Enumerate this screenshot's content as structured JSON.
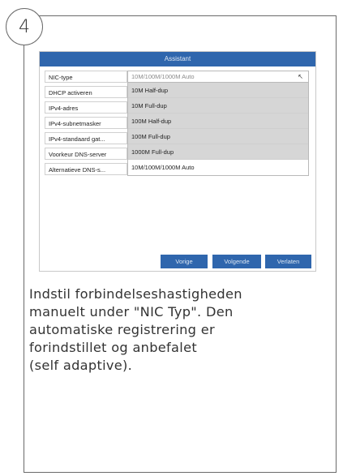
{
  "step_number": "4",
  "window": {
    "title": "Assistant"
  },
  "form": {
    "labels": [
      "NIC-type",
      "DHCP activeren",
      "IPv4-adres",
      "IPv4-subnetmasker",
      "IPv4-standaard gat...",
      "Voorkeur DNS-server",
      "Alternatieve DNS-s..."
    ],
    "nic_type_selected": "10M/100M/1000M Auto",
    "nic_type_options": [
      "10M Half-dup",
      "10M Full-dup",
      "100M Half-dup",
      "100M Full-dup",
      "1000M Full-dup",
      "10M/100M/1000M Auto"
    ]
  },
  "buttons": {
    "previous": "Vorige",
    "next": "Volgende",
    "exit": "Verlaten"
  },
  "caption": "Indstil forbindelseshastigheden\nmanuelt under \"NIC Typ\". Den\nautomatiske registrering er\nforindstillet og anbefalet\n(self adaptive).",
  "colors": {
    "accent": "#2f66ad",
    "dropdown_option_bg": "#d6d6d6",
    "border": "#6a6a6a"
  }
}
